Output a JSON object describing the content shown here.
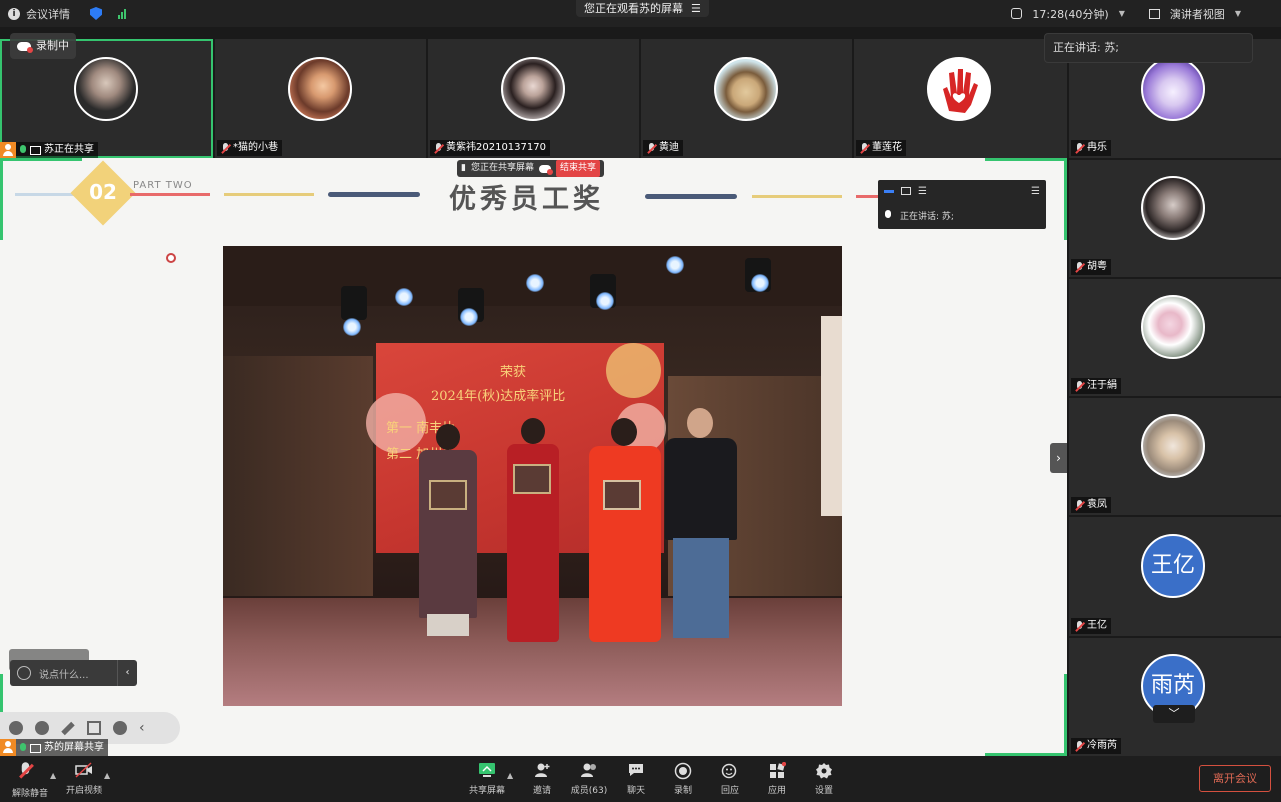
{
  "topbar": {
    "meeting_info": "会议详情",
    "viewing_banner": "您正在观看苏的屏幕",
    "timer": "17:28(40分钟)",
    "view_mode": "演讲者视图"
  },
  "recording": {
    "label": "录制中"
  },
  "speaking_banner": "正在讲话:  苏;",
  "top_participants": [
    {
      "name": "苏正在共享"
    },
    {
      "name": "*猫的小巷"
    },
    {
      "name": "黄紫祎20210137170"
    },
    {
      "name": "黄迪"
    },
    {
      "name": "董莲花"
    }
  ],
  "side_participants": [
    {
      "name": "冉乐",
      "avatar_text": ""
    },
    {
      "name": "胡粤",
      "avatar_text": ""
    },
    {
      "name": "汪于絹",
      "avatar_text": ""
    },
    {
      "name": "袁凤",
      "avatar_text": ""
    },
    {
      "name": "王亿",
      "avatar_text": "王亿"
    },
    {
      "name": "冷雨芮",
      "avatar_text": "雨芮"
    }
  ],
  "share": {
    "pill_status": "您正在共享屏幕",
    "pill_end": "结束共享",
    "mini_speaking": "正在讲话:  苏;",
    "bottom_tag": "苏的屏幕共享"
  },
  "slide": {
    "badge_number": "02",
    "part_label": "PART TWO",
    "title": "优秀员工奖",
    "backdrop_line1": "荣获",
    "backdrop_line2": "2024年(秋)达成率评比",
    "backdrop_line3": "第一  南丰片",
    "backdrop_line4": "第二  加州片"
  },
  "chat": {
    "placeholder": "说点什么..."
  },
  "toolbar": {
    "unmute": "解除静音",
    "start_video": "开启视频",
    "share_screen": "共享屏幕",
    "invite": "邀请",
    "members": "成员(63)",
    "chat": "聊天",
    "record": "录制",
    "reactions": "回应",
    "apps": "应用",
    "settings": "设置",
    "leave": "离开会议"
  },
  "colors": {
    "accent_green": "#35c46f",
    "leave_red": "#d4503f",
    "avatar_blue": "#3a6fc8"
  }
}
